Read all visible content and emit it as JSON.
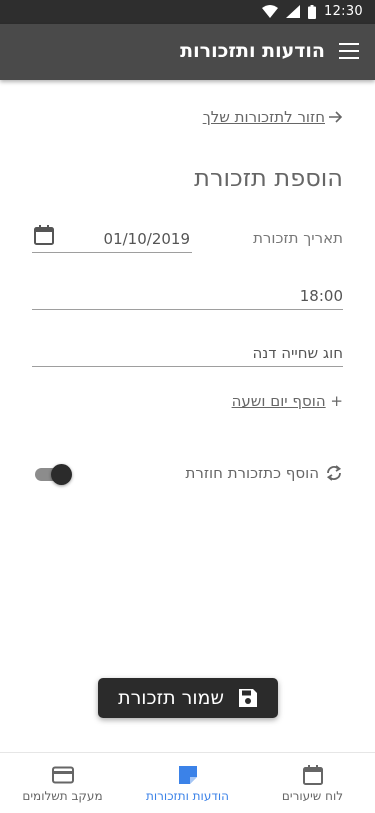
{
  "status_bar": {
    "time": "12:30"
  },
  "app_bar": {
    "title": "הודעות ותזכורות"
  },
  "back_link": {
    "text": "חזור לתזכורות שלך"
  },
  "page_title": "הוספת תזכורת",
  "form": {
    "date_label": "תאריך תזכורת",
    "date_value": "01/10/2019",
    "time_value": "18:00",
    "message_value": "חוג שחייה דנה",
    "add_time_plus": "+",
    "add_time_label": "הוסף יום ושעה",
    "recurring_label": "הוסף כתזכורת חוזרת",
    "recurring_on": true
  },
  "save_button": {
    "label": "שמור תזכורת"
  },
  "bottom_nav": {
    "items": [
      {
        "label": "לוח שיעורים",
        "icon": "calendar-icon",
        "active": false
      },
      {
        "label": "הודעות ותזכורות",
        "icon": "note-icon",
        "active": true
      },
      {
        "label": "מעקב תשלומים",
        "icon": "credit-card-icon",
        "active": false
      }
    ],
    "active_color": "#3b82e8"
  },
  "colors": {
    "app_bar": "#4a4a4a",
    "status_bar": "#2e2e2e",
    "accent": "#3b82e8"
  }
}
